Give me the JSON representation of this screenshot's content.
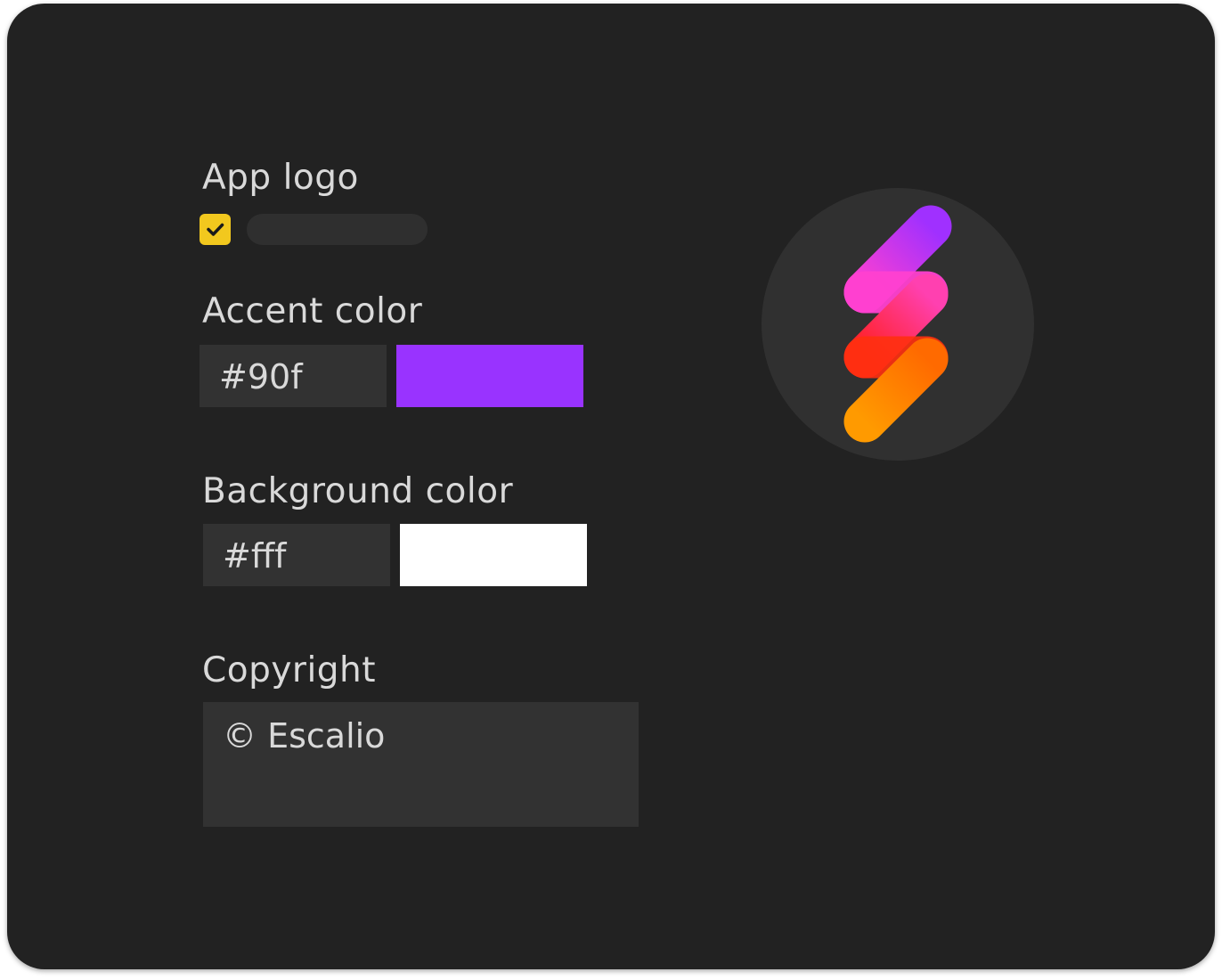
{
  "app_logo": {
    "label": "App logo",
    "checked": true
  },
  "accent_color": {
    "label": "Accent color",
    "value": "#90f",
    "swatch": "#9933ff"
  },
  "background_color": {
    "label": "Background color",
    "value": "#fff",
    "swatch": "#ffffff"
  },
  "copyright": {
    "label": "Copyright",
    "value": "© Escalio"
  },
  "logo": {
    "name": "escalio-logo",
    "colors": [
      "#a030ff",
      "#ff40d0",
      "#ff2020",
      "#ff8a00"
    ]
  },
  "colors": {
    "panel": "#222222",
    "field": "#323232",
    "text": "#d9d9d9",
    "checkbox": "#f2c81e"
  }
}
